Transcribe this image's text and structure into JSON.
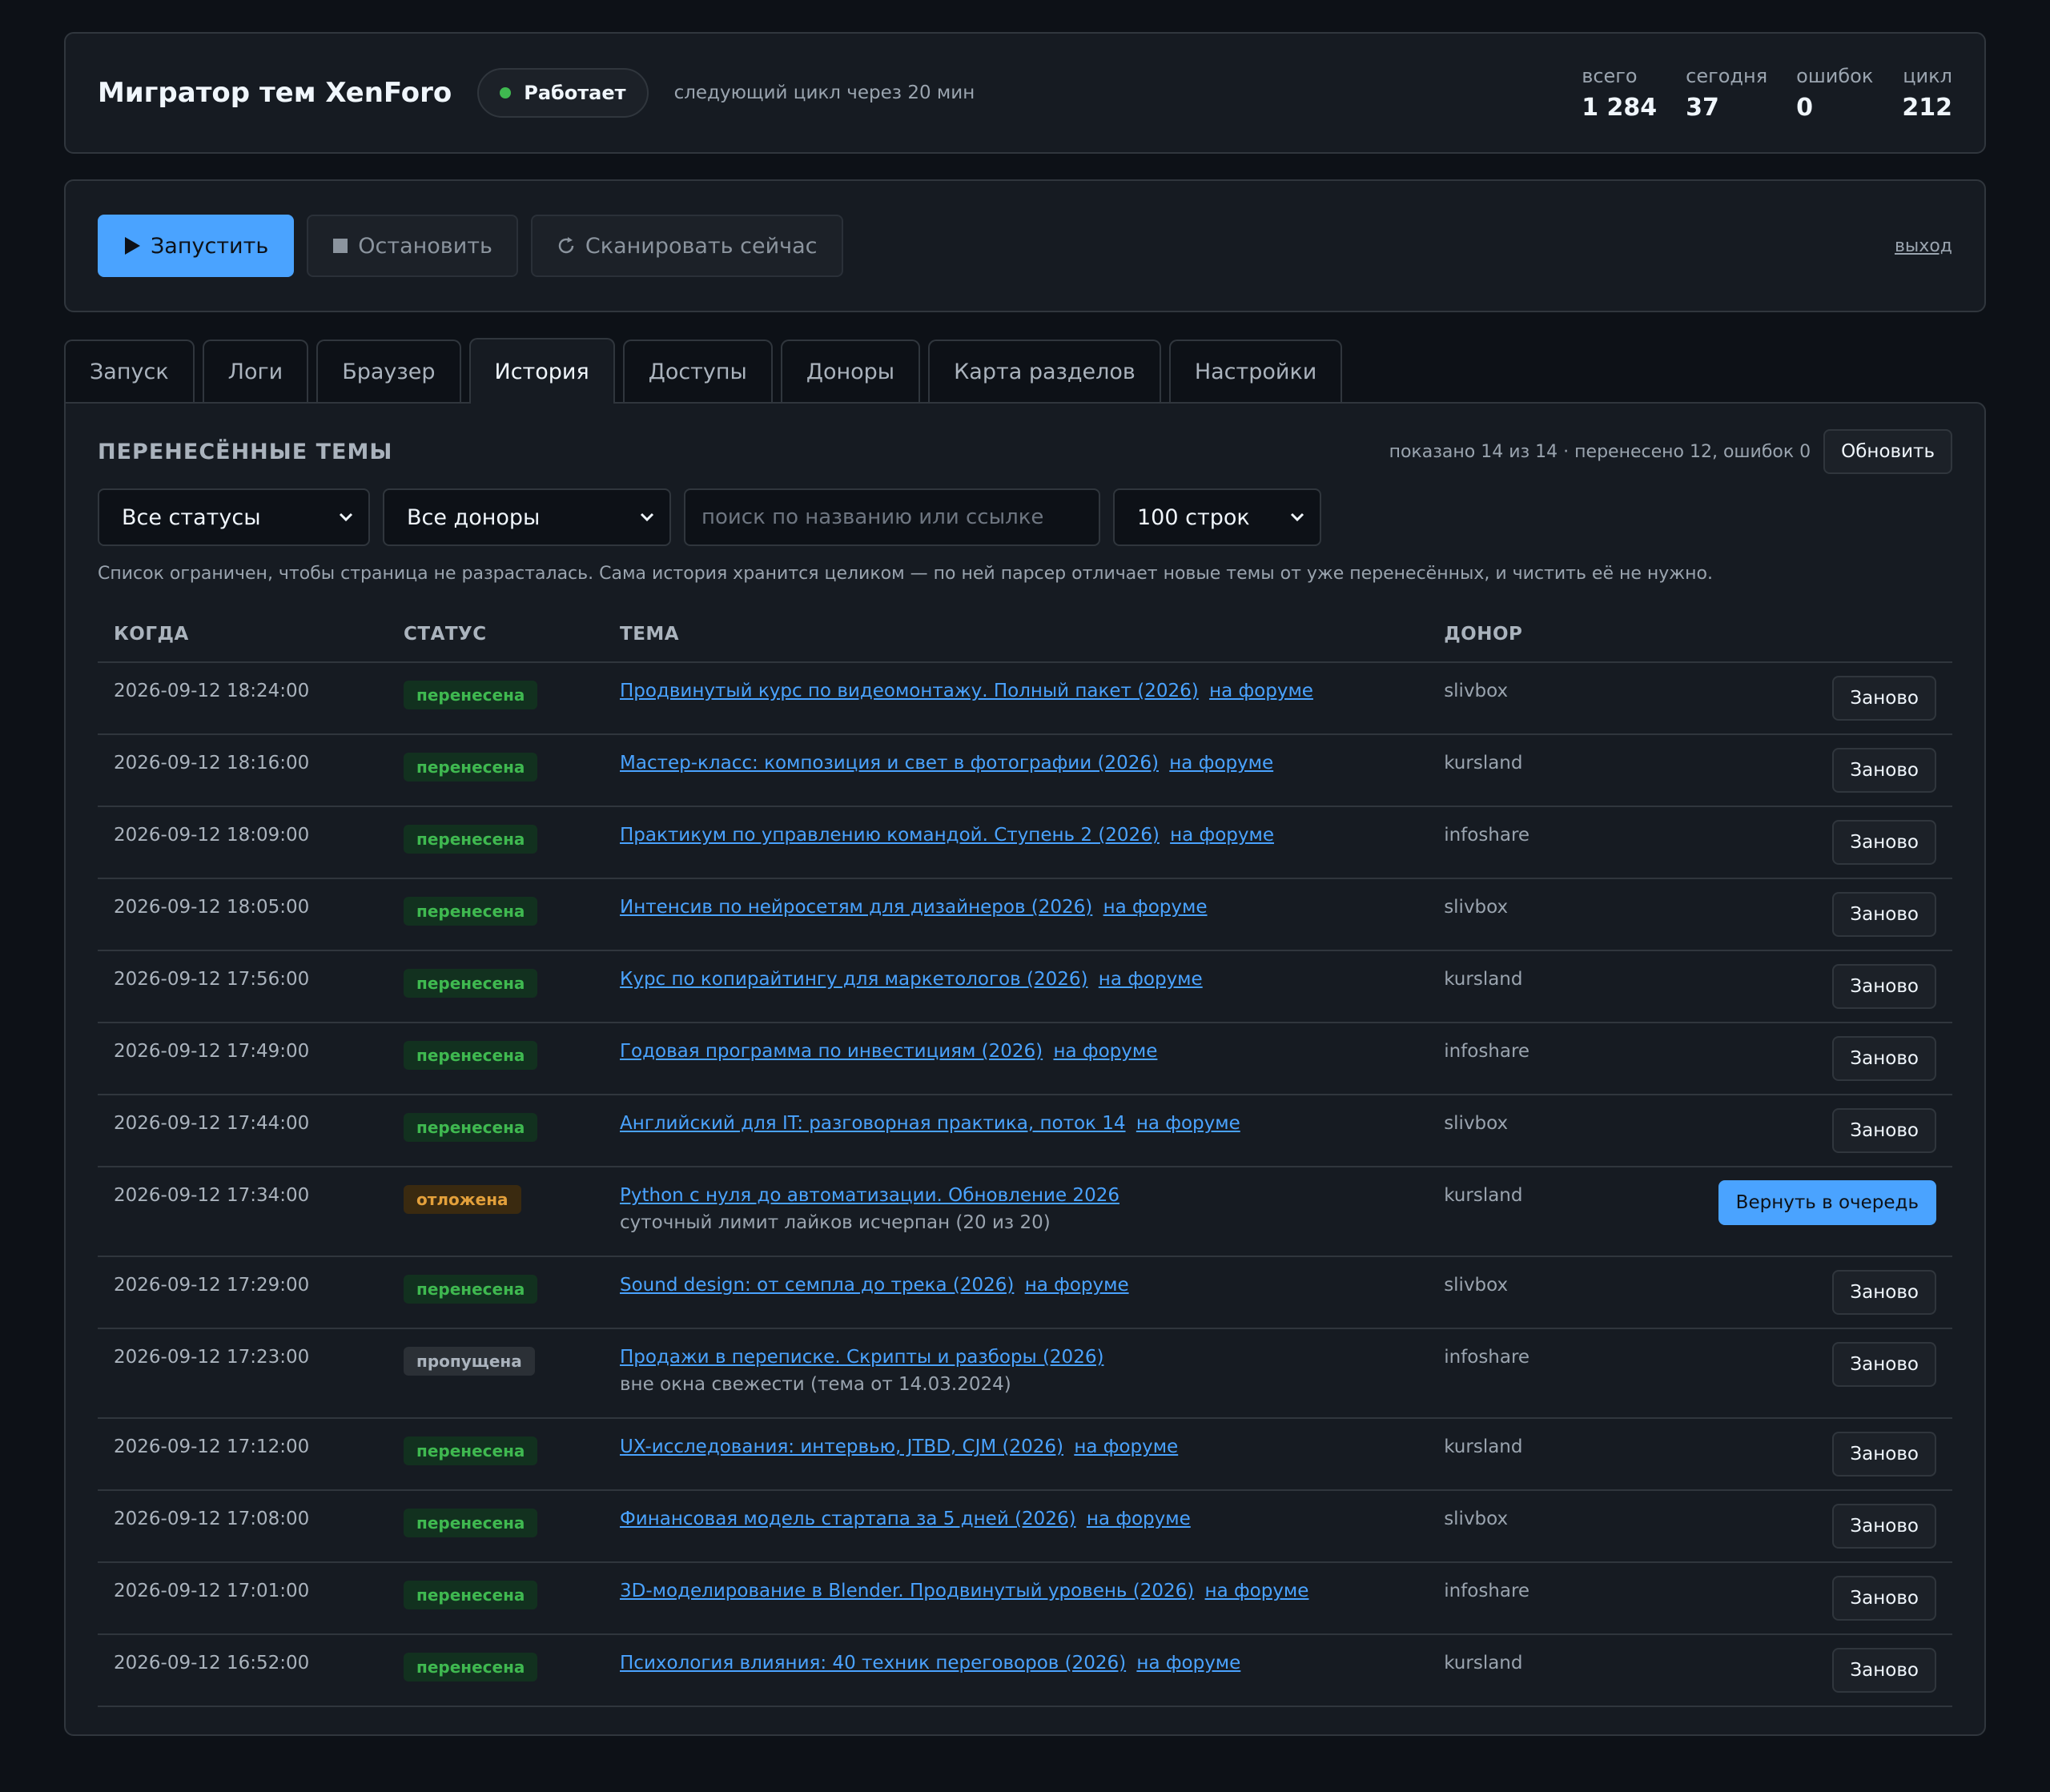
{
  "header": {
    "title": "Мигратор тем XenForo",
    "status": "Работает",
    "next_cycle": "следующий цикл через 20 мин",
    "stats": [
      {
        "label": "всего",
        "value": "1 284"
      },
      {
        "label": "сегодня",
        "value": "37"
      },
      {
        "label": "ошибок",
        "value": "0"
      },
      {
        "label": "цикл",
        "value": "212"
      }
    ],
    "colors": {
      "status_dot": "#3fb950",
      "accent": "#4aa3ff"
    }
  },
  "controls": {
    "start": "Запустить",
    "stop": "Остановить",
    "scan": "Сканировать сейчас",
    "logout": "выход"
  },
  "tabs": [
    "Запуск",
    "Логи",
    "Браузер",
    "История",
    "Доступы",
    "Доноры",
    "Карта разделов",
    "Настройки"
  ],
  "active_tab": "История",
  "history": {
    "title": "ПЕРЕНЕСЁННЫЕ ТЕМЫ",
    "summary": "показано 14 из 14 · перенесено 12, ошибок 0",
    "refresh": "Обновить",
    "filters": {
      "status": "Все статусы",
      "donor": "Все доноры",
      "search_placeholder": "поиск по названию или ссылке",
      "rows": "100 строк"
    },
    "note": "Список ограничен, чтобы страница не разрасталась. Сама история хранится целиком — по ней парсер отличает новые темы от уже перенесённых, и чистить её не нужно.",
    "columns": {
      "when": "КОГДА",
      "status": "СТАТУС",
      "topic": "ТЕМА",
      "donor": "ДОНОР"
    },
    "forum_link": "на форуме",
    "redo": "Заново",
    "requeue": "Вернуть в очередь",
    "rows": [
      {
        "when": "2026-09-12 18:24:00",
        "status": "перенесена",
        "kind": "ok",
        "topic": "Продвинутый курс по видеомонтажу. Полный пакет (2026)",
        "donor": "slivbox"
      },
      {
        "when": "2026-09-12 18:16:00",
        "status": "перенесена",
        "kind": "ok",
        "topic": "Мастер-класс: композиция и свет в фотографии (2026)",
        "donor": "kursland"
      },
      {
        "when": "2026-09-12 18:09:00",
        "status": "перенесена",
        "kind": "ok",
        "topic": "Практикум по управлению командой. Ступень 2 (2026)",
        "donor": "infoshare"
      },
      {
        "when": "2026-09-12 18:05:00",
        "status": "перенесена",
        "kind": "ok",
        "topic": "Интенсив по нейросетям для дизайнеров (2026)",
        "donor": "slivbox"
      },
      {
        "when": "2026-09-12 17:56:00",
        "status": "перенесена",
        "kind": "ok",
        "topic": "Курс по копирайтингу для маркетологов (2026)",
        "donor": "kursland"
      },
      {
        "when": "2026-09-12 17:49:00",
        "status": "перенесена",
        "kind": "ok",
        "topic": "Годовая программа по инвестициям (2026)",
        "donor": "infoshare"
      },
      {
        "when": "2026-09-12 17:44:00",
        "status": "перенесена",
        "kind": "ok",
        "topic": "Английский для IT: разговорная практика, поток 14",
        "donor": "slivbox"
      },
      {
        "when": "2026-09-12 17:34:00",
        "status": "отложена",
        "kind": "wait",
        "topic": "Python с нуля до автоматизации. Обновление 2026",
        "reason": "суточный лимит лайков исчерпан (20 из 20)",
        "donor": "kursland"
      },
      {
        "when": "2026-09-12 17:29:00",
        "status": "перенесена",
        "kind": "ok",
        "topic": "Sound design: от семпла до трека (2026)",
        "donor": "slivbox"
      },
      {
        "when": "2026-09-12 17:23:00",
        "status": "пропущена",
        "kind": "skip",
        "topic": "Продажи в переписке. Скрипты и разборы (2026)",
        "reason": "вне окна свежести (тема от 14.03.2024)",
        "donor": "infoshare"
      },
      {
        "when": "2026-09-12 17:12:00",
        "status": "перенесена",
        "kind": "ok",
        "topic": "UX-исследования: интервью, JTBD, CJM (2026)",
        "donor": "kursland"
      },
      {
        "when": "2026-09-12 17:08:00",
        "status": "перенесена",
        "kind": "ok",
        "topic": "Финансовая модель стартапа за 5 дней (2026)",
        "donor": "slivbox"
      },
      {
        "when": "2026-09-12 17:01:00",
        "status": "перенесена",
        "kind": "ok",
        "topic": "3D-моделирование в Blender. Продвинутый уровень (2026)",
        "donor": "infoshare"
      },
      {
        "when": "2026-09-12 16:52:00",
        "status": "перенесена",
        "kind": "ok",
        "topic": "Психология влияния: 40 техник переговоров (2026)",
        "donor": "kursland"
      }
    ]
  }
}
